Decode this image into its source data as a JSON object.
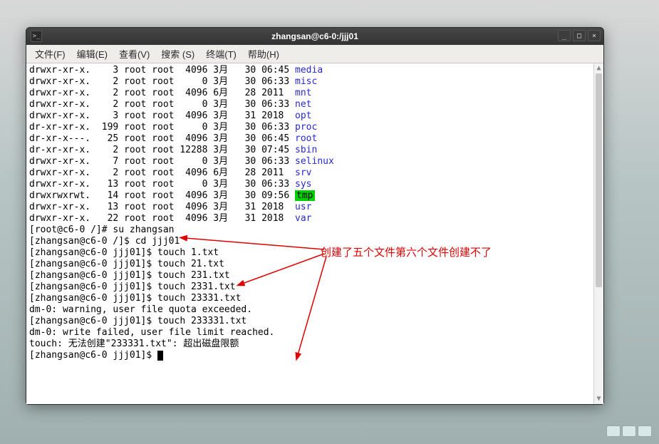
{
  "window": {
    "title": "zhangsan@c6-0:/jjj01",
    "controls": {
      "min": "_",
      "max": "□",
      "close": "×"
    }
  },
  "menubar": [
    "文件(F)",
    "编辑(E)",
    "查看(V)",
    "搜索 (S)",
    "终端(T)",
    "帮助(H)"
  ],
  "ls": [
    {
      "perm": "drwxr-xr-x.",
      "links": "3",
      "owner": "root",
      "group": "root",
      "size": "4096",
      "mon": "3月",
      "day": "30",
      "time": "06:45",
      "name": "media",
      "type": "dir"
    },
    {
      "perm": "drwxr-xr-x.",
      "links": "2",
      "owner": "root",
      "group": "root",
      "size": "0",
      "mon": "3月",
      "day": "30",
      "time": "06:33",
      "name": "misc",
      "type": "dir"
    },
    {
      "perm": "drwxr-xr-x.",
      "links": "2",
      "owner": "root",
      "group": "root",
      "size": "4096",
      "mon": "6月",
      "day": "28",
      "time": "2011",
      "name": "mnt",
      "type": "dir"
    },
    {
      "perm": "drwxr-xr-x.",
      "links": "2",
      "owner": "root",
      "group": "root",
      "size": "0",
      "mon": "3月",
      "day": "30",
      "time": "06:33",
      "name": "net",
      "type": "dir"
    },
    {
      "perm": "drwxr-xr-x.",
      "links": "3",
      "owner": "root",
      "group": "root",
      "size": "4096",
      "mon": "3月",
      "day": "31",
      "time": "2018",
      "name": "opt",
      "type": "dir"
    },
    {
      "perm": "dr-xr-xr-x.",
      "links": "199",
      "owner": "root",
      "group": "root",
      "size": "0",
      "mon": "3月",
      "day": "30",
      "time": "06:33",
      "name": "proc",
      "type": "dir"
    },
    {
      "perm": "dr-xr-x---.",
      "links": "25",
      "owner": "root",
      "group": "root",
      "size": "4096",
      "mon": "3月",
      "day": "30",
      "time": "06:45",
      "name": "root",
      "type": "dir"
    },
    {
      "perm": "dr-xr-xr-x.",
      "links": "2",
      "owner": "root",
      "group": "root",
      "size": "12288",
      "mon": "3月",
      "day": "30",
      "time": "07:45",
      "name": "sbin",
      "type": "dir"
    },
    {
      "perm": "drwxr-xr-x.",
      "links": "7",
      "owner": "root",
      "group": "root",
      "size": "0",
      "mon": "3月",
      "day": "30",
      "time": "06:33",
      "name": "selinux",
      "type": "dir"
    },
    {
      "perm": "drwxr-xr-x.",
      "links": "2",
      "owner": "root",
      "group": "root",
      "size": "4096",
      "mon": "6月",
      "day": "28",
      "time": "2011",
      "name": "srv",
      "type": "dir"
    },
    {
      "perm": "drwxr-xr-x.",
      "links": "13",
      "owner": "root",
      "group": "root",
      "size": "0",
      "mon": "3月",
      "day": "30",
      "time": "06:33",
      "name": "sys",
      "type": "dir"
    },
    {
      "perm": "drwxrwxrwt.",
      "links": "14",
      "owner": "root",
      "group": "root",
      "size": "4096",
      "mon": "3月",
      "day": "30",
      "time": "09:56",
      "name": "tmp",
      "type": "tmp"
    },
    {
      "perm": "drwxr-xr-x.",
      "links": "13",
      "owner": "root",
      "group": "root",
      "size": "4096",
      "mon": "3月",
      "day": "31",
      "time": "2018",
      "name": "usr",
      "type": "dir"
    },
    {
      "perm": "drwxr-xr-x.",
      "links": "22",
      "owner": "root",
      "group": "root",
      "size": "4096",
      "mon": "3月",
      "day": "31",
      "time": "2018",
      "name": "var",
      "type": "dir"
    }
  ],
  "session": [
    {
      "prompt": "[root@c6-0 /]#",
      "cmd": "su zhangsan"
    },
    {
      "prompt": "[zhangsan@c6-0 /]$",
      "cmd": "cd jjj01"
    },
    {
      "prompt": "[zhangsan@c6-0 jjj01]$",
      "cmd": "touch 1.txt"
    },
    {
      "prompt": "[zhangsan@c6-0 jjj01]$",
      "cmd": "touch 21.txt"
    },
    {
      "prompt": "[zhangsan@c6-0 jjj01]$",
      "cmd": "touch 231.txt"
    },
    {
      "prompt": "[zhangsan@c6-0 jjj01]$",
      "cmd": "touch 2331.txt"
    },
    {
      "prompt": "[zhangsan@c6-0 jjj01]$",
      "cmd": "touch 23331.txt"
    }
  ],
  "warn1": "dm-0: warning, user file quota exceeded.",
  "touch6": {
    "prompt": "[zhangsan@c6-0 jjj01]$",
    "cmd": "touch 233331.txt"
  },
  "err1": "dm-0: write failed, user file limit reached.",
  "err2": "touch: 无法创建\"233331.txt\": 超出磁盘限额",
  "final_prompt": "[zhangsan@c6-0 jjj01]$",
  "annotation": "创建了五个文件第六个文件创建不了"
}
